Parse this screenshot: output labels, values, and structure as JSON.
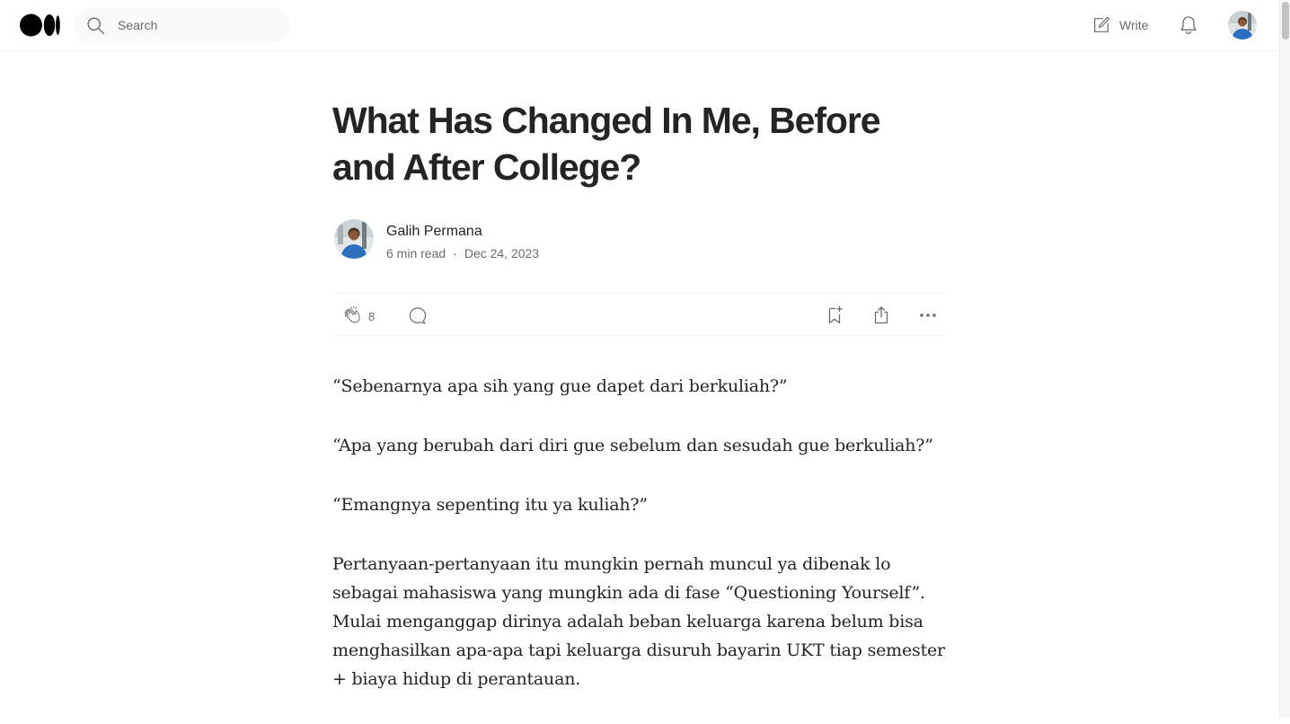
{
  "header": {
    "logo_icon": "medium-logo-icon",
    "search": {
      "placeholder": "Search",
      "value": ""
    },
    "write_label": "Write",
    "write_icon": "write-icon",
    "notifications_icon": "bell-icon"
  },
  "article": {
    "title": "What Has Changed In Me, Before and After College?",
    "author": {
      "name": "Galih Permana"
    },
    "read_time": "6 min read",
    "separator": "·",
    "date": "Dec 24, 2023",
    "actions": {
      "clap_count": "8",
      "clap_icon": "clap-icon",
      "comment_icon": "comment-icon",
      "save_icon": "bookmark-add-icon",
      "share_icon": "share-icon",
      "more_icon": "more-icon"
    },
    "paragraphs": [
      "“Sebenarnya apa sih yang gue dapet dari berkuliah?”",
      "“Apa yang berubah dari diri gue sebelum dan sesudah gue berkuliah?”",
      "“Emangnya sepenting itu ya kuliah?”",
      "Pertanyaan-pertanyaan itu mungkin pernah muncul ya dibenak lo sebagai mahasiswa yang mungkin ada di fase “Questioning Yourself”. Mulai menganggap dirinya adalah beban keluarga karena belum bisa menghasilkan apa-apa tapi keluarga disuruh bayarin UKT tiap semester + biaya hidup di perantauan."
    ]
  },
  "colors": {
    "text": "#242424",
    "muted": "#6b6b6b",
    "divider": "#f2f2f2",
    "search_bg": "#f9f9f9"
  }
}
